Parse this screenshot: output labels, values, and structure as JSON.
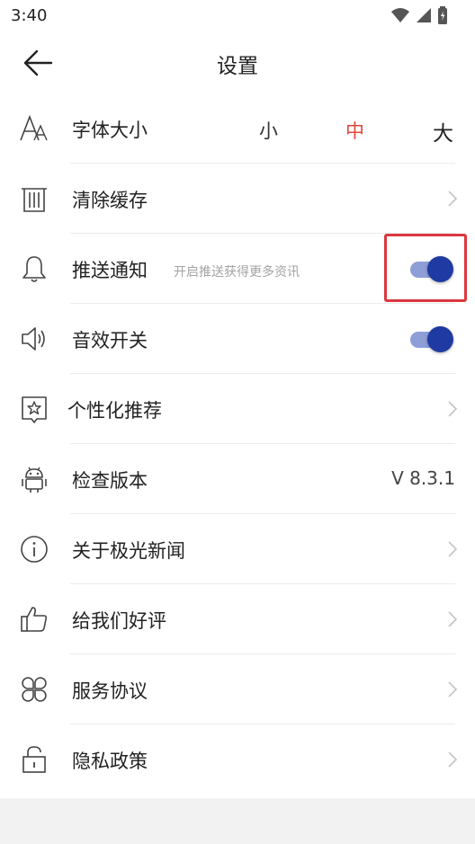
{
  "status_bar": {
    "time": "3:40",
    "icons": [
      "wifi-icon",
      "signal-icon",
      "battery-icon"
    ]
  },
  "header": {
    "title": "设置",
    "back_icon": "arrow-left-icon"
  },
  "settings": {
    "font_size": {
      "label": "字体大小",
      "icon": "font-size-icon",
      "options": [
        "小",
        "中",
        "大"
      ],
      "selected": "中",
      "selected_color": "#e0463c"
    },
    "clear_cache": {
      "label": "清除缓存",
      "icon": "trash-icon"
    },
    "push": {
      "label": "推送通知",
      "sublabel": "开启推送获得更多资讯",
      "icon": "bell-icon",
      "enabled": true
    },
    "sound": {
      "label": "音效开关",
      "icon": "speaker-icon",
      "enabled": true
    },
    "personalized": {
      "label": "个性化推荐",
      "icon": "star-frame-icon"
    },
    "check_version": {
      "label": "检查版本",
      "icon": "android-icon",
      "version": "V 8.3.1"
    },
    "about": {
      "label": "关于极光新闻",
      "icon": "info-icon"
    },
    "rate": {
      "label": "给我们好评",
      "icon": "thumbs-up-icon"
    },
    "service": {
      "label": "服务协议",
      "icon": "clover-icon"
    },
    "privacy": {
      "label": "隐私政策",
      "icon": "lock-icon"
    }
  },
  "colors": {
    "accent_blue": "#1f3aa2",
    "track_blue": "#8e9ed7",
    "highlight_red": "#d9383f"
  }
}
